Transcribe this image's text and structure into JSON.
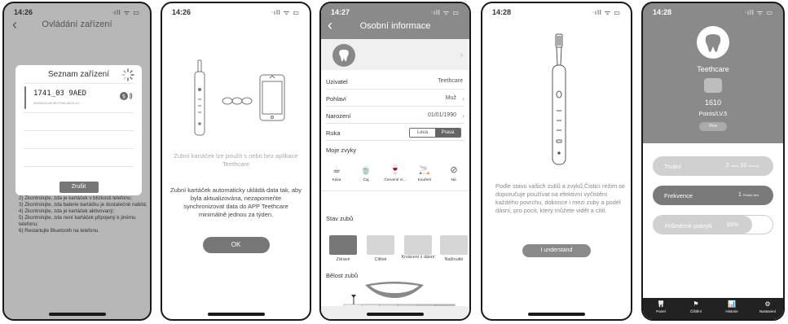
{
  "status": {
    "p1_time": "14:26",
    "p2_time": "14:26",
    "p3_time": "14:27",
    "p4_time": "14:28",
    "p5_time": "14:28",
    "signal": "ᐧıll ᯤ ▭"
  },
  "screen1": {
    "title": "Ovládání zařízení",
    "dialog_title": "Seznam zařízení",
    "device_name": "1741_03  9AED",
    "device_id": "39834244-8F0B-F930-A6C5-A7...",
    "cancel_label": "Zrušit",
    "tips": [
      "2) Zkontrolujte, zda je kartáček v blízkosti telefonu;",
      "3) Zkontrolujte, zda baterie kartáčku je dostatečně nabitá;",
      "4) Zkontrolujte, zda je kartáček aktivovaný;",
      "5) Zkontrolujte, zda není kartáček připojený k jinému telefonu;",
      "6) Restartujte Bluetooth na telefonu."
    ]
  },
  "screen2": {
    "text1": "Zubní kartáček lze použít s nebo bez aplikace Teethcare",
    "text2": "Zubní kartáček automaticky ukládá data tak, aby byla aktualizována, nezapomeňte synchronizovat data do APP Teethcare minimálně jednou za týden.",
    "ok_label": "OK"
  },
  "screen3": {
    "title": "Osobní informace",
    "rows": [
      {
        "label": "Uzivatel",
        "value": "Teethcare"
      },
      {
        "label": "Pohlaví",
        "value": "Muž"
      },
      {
        "label": "Narození",
        "value": "01/01/1990"
      }
    ],
    "hand_label": "Ruka",
    "hand_left": "Levá",
    "hand_right": "Pravá",
    "habits_title": "Moje zvyky",
    "habits": [
      {
        "label": "Káva",
        "icon": "coffee-icon",
        "glyph": "☕"
      },
      {
        "label": "Čaj",
        "icon": "tea-icon",
        "glyph": "🍵"
      },
      {
        "label": "Červené ví...",
        "icon": "wine-icon",
        "glyph": "🍷"
      },
      {
        "label": "Kouření",
        "icon": "smoking-icon",
        "glyph": "🚬"
      },
      {
        "label": "Nic",
        "icon": "none-icon",
        "glyph": "⊘"
      }
    ],
    "teeth_title": "Stav zubů",
    "teeth": [
      "Zdravé",
      "Citlivé",
      "Krvácení z dásní",
      "Nažloutlé"
    ],
    "whiteness_title": "Bělost zubů"
  },
  "screen4": {
    "text": "Podle stavu vašich zubů a zvyků,Čisticí režim se doporučuje používat na efektivní vyčistění každého povrchu, dokonce i mezi zuby a podél dásní, pro pocit, který můžete vidět a cítit.",
    "button_label": "I understand"
  },
  "screen5": {
    "app_name": "Teethcare",
    "points": "1610",
    "level": "Points/LV.5",
    "more_label": "Více",
    "duration_label": "Trvání",
    "duration_value": "2",
    "duration_unit1": "minut",
    "duration_value2": "10",
    "duration_unit2": "sekund",
    "frequency_label": "Frekvence",
    "frequency_value": "1",
    "frequency_unit": "Počet/ den",
    "coverage_label": "Průměrné pokrytí",
    "coverage_value": "83%",
    "coverage_fraction": 0.83,
    "tabs": [
      {
        "label": "Panel",
        "icon": "tooth-icon",
        "glyph": "🦷"
      },
      {
        "label": "Čištění",
        "icon": "brush-icon",
        "glyph": "⚑"
      },
      {
        "label": "Historie",
        "icon": "chart-icon",
        "glyph": "📊"
      },
      {
        "label": "Nastavení",
        "icon": "gear-icon",
        "glyph": "⚙"
      }
    ]
  },
  "colors": {
    "accent_gray": "#8a8a8a",
    "dark": "#1a1a1a"
  }
}
